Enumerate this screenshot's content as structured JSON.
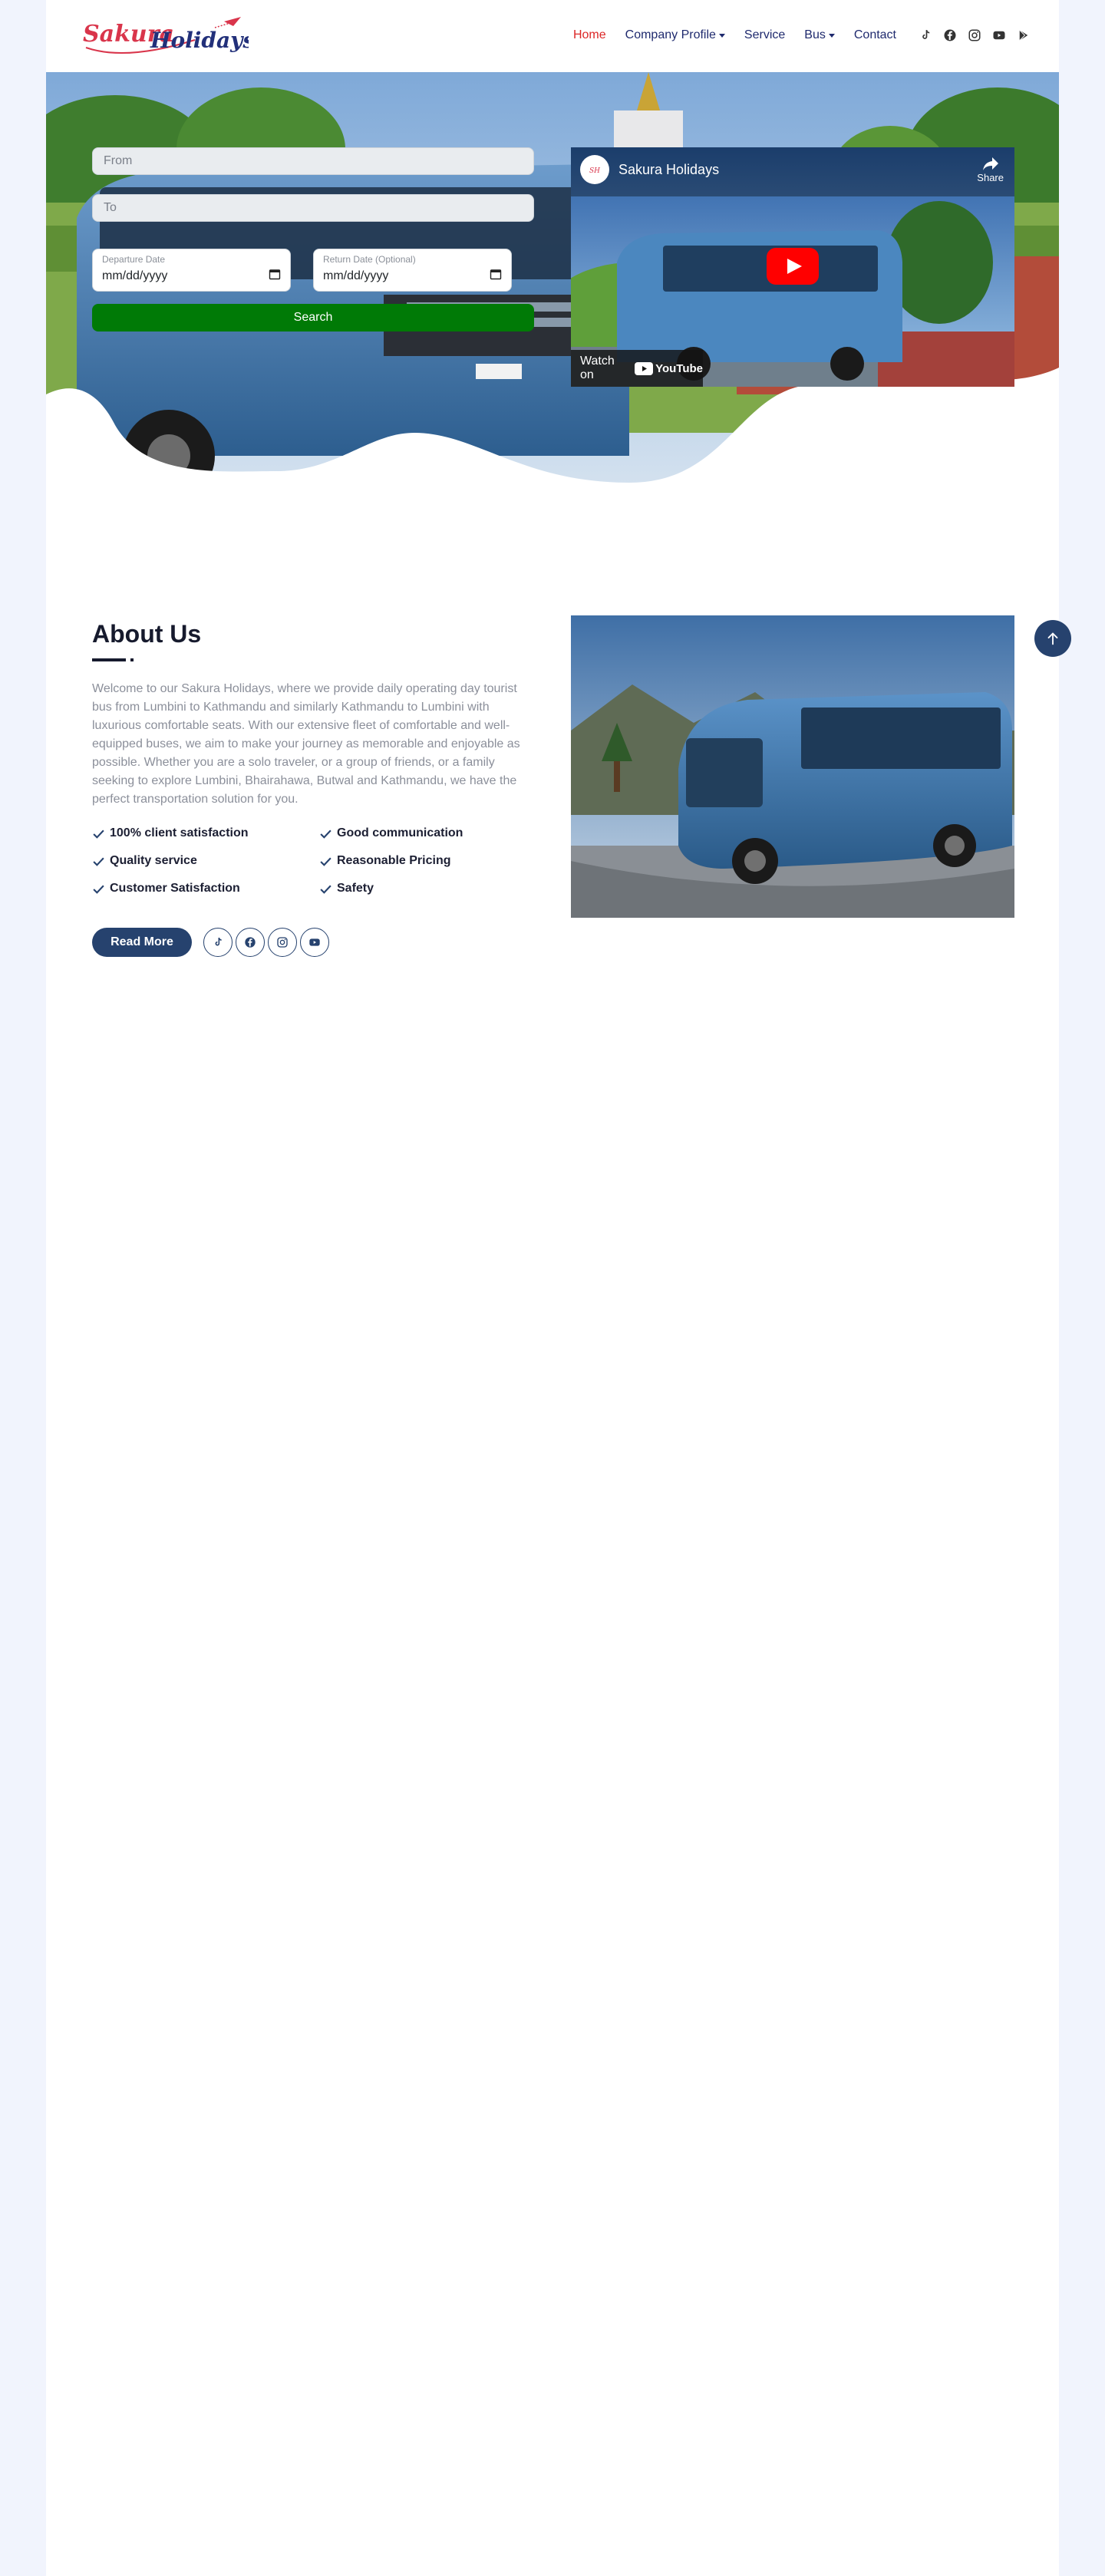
{
  "logo": {
    "alt": "Sakura Holidays",
    "word1": "Sakura",
    "word2": "Holidays"
  },
  "nav": {
    "home": "Home",
    "company_profile": "Company Profile",
    "service": "Service",
    "bus": "Bus",
    "contact": "Contact",
    "icons": [
      "tiktok-icon",
      "facebook-icon",
      "instagram-icon",
      "youtube-icon",
      "google-play-icon"
    ]
  },
  "search": {
    "from_placeholder": "From",
    "to_placeholder": "To",
    "departure_label": "Departure Date",
    "departure_value": "mm/dd/yyyy",
    "return_label": "Return Date (Optional)",
    "return_value": "mm/dd/yyyy",
    "button": "Search"
  },
  "video": {
    "channel_title": "Sakura Holidays",
    "share": "Share",
    "watch_on": "Watch on",
    "youtube": "YouTube"
  },
  "about": {
    "title": "About Us",
    "text": "Welcome to our Sakura Holidays, where we provide daily operating day tourist bus from Lumbini to Kathmandu and similarly Kathmandu to Lumbini with luxurious comfortable seats. With our extensive fleet of comfortable and well-equipped buses, we aim to make your journey as memorable and enjoyable as possible. Whether you are a solo traveler, or a group of friends, or a family seeking to explore Lumbini, Bhairahawa, Butwal and Kathmandu, we have the perfect transportation solution for you.",
    "features": [
      "100% client satisfaction",
      "Good communication",
      "Quality service",
      "Reasonable Pricing",
      "Customer Satisfaction",
      "Safety"
    ],
    "read_more": "Read More"
  },
  "colors": {
    "brand_navy": "#26426e",
    "nav_text": "#1f2a6e",
    "active_red": "#dc2626",
    "search_green": "#007a06",
    "page_bg": "#f1f4fd"
  }
}
